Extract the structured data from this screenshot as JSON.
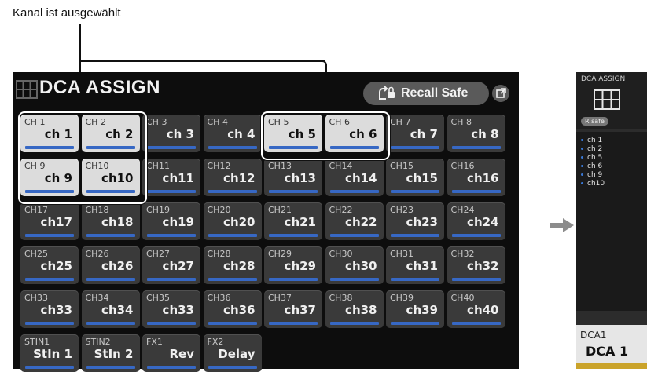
{
  "callout": "Kanal ist ausgewählt",
  "window": {
    "title": "DCA ASSIGN",
    "recall_safe": "Recall Safe",
    "popout_icon": "popout-icon",
    "grid_icon": "grid-icon"
  },
  "channels": [
    {
      "num": "CH 1",
      "name": "ch 1",
      "selected": true
    },
    {
      "num": "CH 2",
      "name": "ch 2",
      "selected": true
    },
    {
      "num": "CH 3",
      "name": "ch 3",
      "selected": false
    },
    {
      "num": "CH 4",
      "name": "ch 4",
      "selected": false
    },
    {
      "num": "CH 5",
      "name": "ch 5",
      "selected": true
    },
    {
      "num": "CH 6",
      "name": "ch 6",
      "selected": true
    },
    {
      "num": "CH 7",
      "name": "ch 7",
      "selected": false
    },
    {
      "num": "CH 8",
      "name": "ch 8",
      "selected": false
    },
    {
      "num": "CH 9",
      "name": "ch 9",
      "selected": true
    },
    {
      "num": "CH10",
      "name": "ch10",
      "selected": true
    },
    {
      "num": "CH11",
      "name": "ch11",
      "selected": false
    },
    {
      "num": "CH12",
      "name": "ch12",
      "selected": false
    },
    {
      "num": "CH13",
      "name": "ch13",
      "selected": false
    },
    {
      "num": "CH14",
      "name": "ch14",
      "selected": false
    },
    {
      "num": "CH15",
      "name": "ch15",
      "selected": false
    },
    {
      "num": "CH16",
      "name": "ch16",
      "selected": false
    },
    {
      "num": "CH17",
      "name": "ch17",
      "selected": false
    },
    {
      "num": "CH18",
      "name": "ch18",
      "selected": false
    },
    {
      "num": "CH19",
      "name": "ch19",
      "selected": false
    },
    {
      "num": "CH20",
      "name": "ch20",
      "selected": false
    },
    {
      "num": "CH21",
      "name": "ch21",
      "selected": false
    },
    {
      "num": "CH22",
      "name": "ch22",
      "selected": false
    },
    {
      "num": "CH23",
      "name": "ch23",
      "selected": false
    },
    {
      "num": "CH24",
      "name": "ch24",
      "selected": false
    },
    {
      "num": "CH25",
      "name": "ch25",
      "selected": false
    },
    {
      "num": "CH26",
      "name": "ch26",
      "selected": false
    },
    {
      "num": "CH27",
      "name": "ch27",
      "selected": false
    },
    {
      "num": "CH28",
      "name": "ch28",
      "selected": false
    },
    {
      "num": "CH29",
      "name": "ch29",
      "selected": false
    },
    {
      "num": "CH30",
      "name": "ch30",
      "selected": false
    },
    {
      "num": "CH31",
      "name": "ch31",
      "selected": false
    },
    {
      "num": "CH32",
      "name": "ch32",
      "selected": false
    },
    {
      "num": "CH33",
      "name": "ch33",
      "selected": false
    },
    {
      "num": "CH34",
      "name": "ch34",
      "selected": false
    },
    {
      "num": "CH35",
      "name": "ch33",
      "selected": false
    },
    {
      "num": "CH36",
      "name": "ch36",
      "selected": false
    },
    {
      "num": "CH37",
      "name": "ch37",
      "selected": false
    },
    {
      "num": "CH38",
      "name": "ch38",
      "selected": false
    },
    {
      "num": "CH39",
      "name": "ch39",
      "selected": false
    },
    {
      "num": "CH40",
      "name": "ch40",
      "selected": false
    },
    {
      "num": "STIN1",
      "name": "StIn 1",
      "selected": false
    },
    {
      "num": "STIN2",
      "name": "StIn 2",
      "selected": false
    },
    {
      "num": "FX1",
      "name": "Rev",
      "selected": false
    },
    {
      "num": "FX2",
      "name": "Delay",
      "selected": false
    }
  ],
  "dca_strip": {
    "header": "DCA ASSIGN",
    "badge": "R safe",
    "assigned": [
      "ch 1",
      "ch 2",
      "ch 5",
      "ch 6",
      "ch 9",
      "ch10"
    ],
    "dca_number": "DCA1",
    "dca_label": "DCA 1"
  },
  "colors": {
    "accent_bar": "#3768c4",
    "selected_bg": "#dcdcdc",
    "unselected_bg": "#3a3a3a",
    "dca_gold": "#caa32a"
  }
}
